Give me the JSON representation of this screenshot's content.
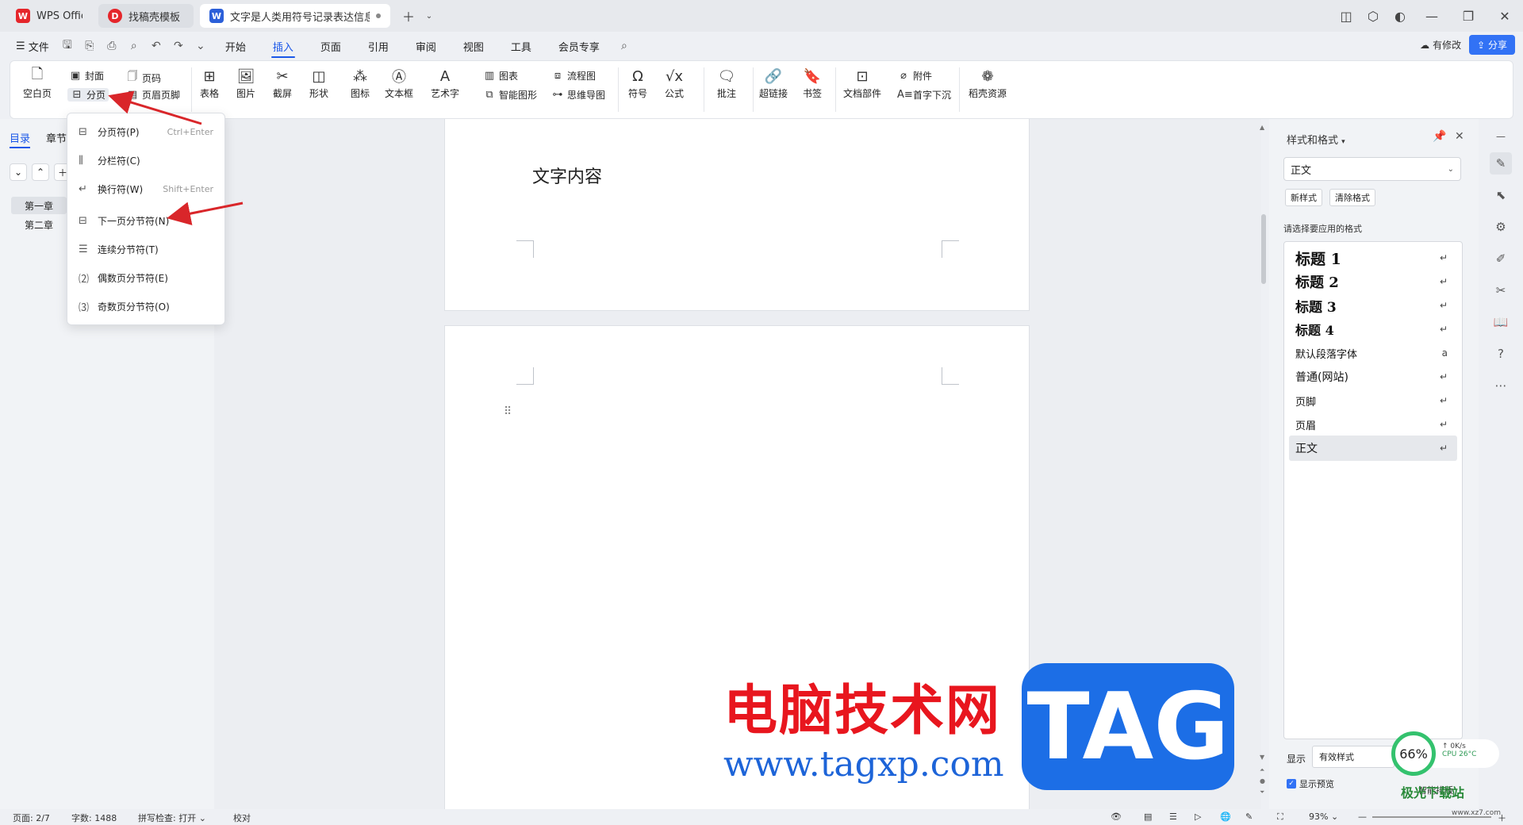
{
  "tabs": [
    {
      "label": "WPS Office",
      "logo": "W"
    },
    {
      "label": "找稿壳模板",
      "logo": "D"
    },
    {
      "label": "文字是人类用符号记录表达信息以",
      "logo": "W"
    }
  ],
  "menu": {
    "file": "文件",
    "items": [
      "开始",
      "插入",
      "页面",
      "引用",
      "审阅",
      "视图",
      "工具",
      "会员专享"
    ],
    "active": "插入",
    "modified": "有修改",
    "share": "分享"
  },
  "ribbon": {
    "blank_page": "空白页",
    "cover": "封面",
    "page_number": "页码",
    "page_break": "分页",
    "header_footer": "页眉页脚",
    "table": "表格",
    "picture": "图片",
    "screenshot": "截屏",
    "shape": "形状",
    "icon": "图标",
    "textbox": "文本框",
    "wordart": "艺术字",
    "chart": "图表",
    "smart_graphic": "智能图形",
    "flowchart": "流程图",
    "mindmap": "思维导图",
    "symbol": "符号",
    "formula": "公式",
    "comment": "批注",
    "hyperlink": "超链接",
    "bookmark": "书签",
    "doc_parts": "文档部件",
    "attachment": "附件",
    "drop_cap": "首字下沉",
    "resources": "稻壳资源"
  },
  "left_panel": {
    "tab_toc": "目录",
    "tab_chapter": "章节",
    "chapters": [
      "第一章",
      "第二章"
    ]
  },
  "dropdown": [
    {
      "label": "分页符(P)",
      "shortcut": "Ctrl+Enter"
    },
    {
      "label": "分栏符(C)",
      "shortcut": ""
    },
    {
      "label": "换行符(W)",
      "shortcut": "Shift+Enter"
    },
    {
      "label": "下一页分节符(N)",
      "shortcut": ""
    },
    {
      "label": "连续分节符(T)",
      "shortcut": ""
    },
    {
      "label": "偶数页分节符(E)",
      "shortcut": ""
    },
    {
      "label": "奇数页分节符(O)",
      "shortcut": ""
    }
  ],
  "document": {
    "page1_text": "文字内容"
  },
  "style_panel": {
    "title": "样式和格式",
    "current": "正文",
    "new_style": "新样式",
    "clear_format": "清除格式",
    "apply_label": "请选择要应用的格式",
    "styles": [
      "标题  1",
      "标题  2",
      "标题  3",
      "标题 4",
      "默认段落字体",
      "普通(网站)",
      "页脚",
      "页眉",
      "正文"
    ],
    "show_label": "显示",
    "show_value": "有效样式",
    "preview_label": "显示预览"
  },
  "status": {
    "page": "页面: 2/7",
    "words": "字数: 1488",
    "spell": "拼写检查: 打开",
    "proof": "校对",
    "zoom": "93%"
  },
  "overlay": {
    "site_cn": "电脑技术网",
    "site_url": "www.tagxp.com",
    "tag": "TAG",
    "cpu_percent": "66%",
    "net_speed": "0K/s",
    "cpu_temp": "CPU 26°C",
    "smart_layout": "智能排版",
    "xz_logo": "极光下载站",
    "xz_url": "www.xz7.com"
  },
  "colors": {
    "accent": "#1a57e8",
    "share": "#3272f5",
    "arrow": "#d9262a",
    "tag_blue": "#1c6ee6",
    "cn_red": "#e8161e"
  }
}
